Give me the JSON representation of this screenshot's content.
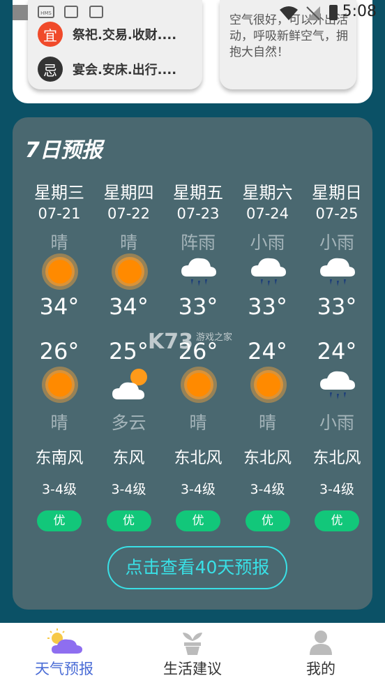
{
  "status_bar": {
    "time": "5:08",
    "icon_labels": [
      "HMS"
    ]
  },
  "almanac": {
    "yi": {
      "badge": "宜",
      "text": "祭祀.交易.收财....",
      "color": "#f04a2a"
    },
    "ji": {
      "badge": "忌",
      "text": "宴会.安床.出行....",
      "color": "#333333"
    }
  },
  "advice": {
    "text": "空气很好，可以外出活动，呼吸新鲜空气，拥抱大自然！"
  },
  "forecast": {
    "title": "7日预报",
    "days": [
      {
        "weekday": "星期三",
        "date": "07-21",
        "day_cond": "晴",
        "day_icon": "sun-icon",
        "high": "34°",
        "low": "26°",
        "night_icon": "sun-icon",
        "night_cond": "晴",
        "wind": "东南风",
        "level": "3-4级",
        "aqi": "优"
      },
      {
        "weekday": "星期四",
        "date": "07-22",
        "day_cond": "晴",
        "day_icon": "sun-icon",
        "high": "34°",
        "low": "25°",
        "night_icon": "partly-cloudy-icon",
        "night_cond": "多云",
        "wind": "东风",
        "level": "3-4级",
        "aqi": "优"
      },
      {
        "weekday": "星期五",
        "date": "07-23",
        "day_cond": "阵雨",
        "day_icon": "rain-cloud-icon",
        "high": "33°",
        "low": "26°",
        "night_icon": "sun-icon",
        "night_cond": "晴",
        "wind": "东北风",
        "level": "3-4级",
        "aqi": "优"
      },
      {
        "weekday": "星期六",
        "date": "07-24",
        "day_cond": "小雨",
        "day_icon": "rain-cloud-icon",
        "high": "33°",
        "low": "24°",
        "night_icon": "sun-icon",
        "night_cond": "晴",
        "wind": "东北风",
        "level": "3-4级",
        "aqi": "优"
      },
      {
        "weekday": "星期日",
        "date": "07-25",
        "day_cond": "小雨",
        "day_icon": "rain-cloud-icon",
        "high": "33°",
        "low": "24°",
        "night_icon": "rain-cloud-icon",
        "night_cond": "小雨",
        "wind": "东北风",
        "level": "3-4级",
        "aqi": "优"
      }
    ],
    "cta": "点击查看40天预报"
  },
  "watermark": {
    "brand": "K73",
    "sub": "游戏之家"
  },
  "nav": {
    "items": [
      {
        "label": "天气预报",
        "icon": "weather-icon",
        "active": true
      },
      {
        "label": "生活建议",
        "icon": "plant-icon",
        "active": false
      },
      {
        "label": "我的",
        "icon": "user-icon",
        "active": false
      }
    ]
  },
  "colors": {
    "active": "#4a6cd6",
    "inactive": "#333333",
    "aqi_good": "#12c77a",
    "cta": "#39e0e6"
  }
}
